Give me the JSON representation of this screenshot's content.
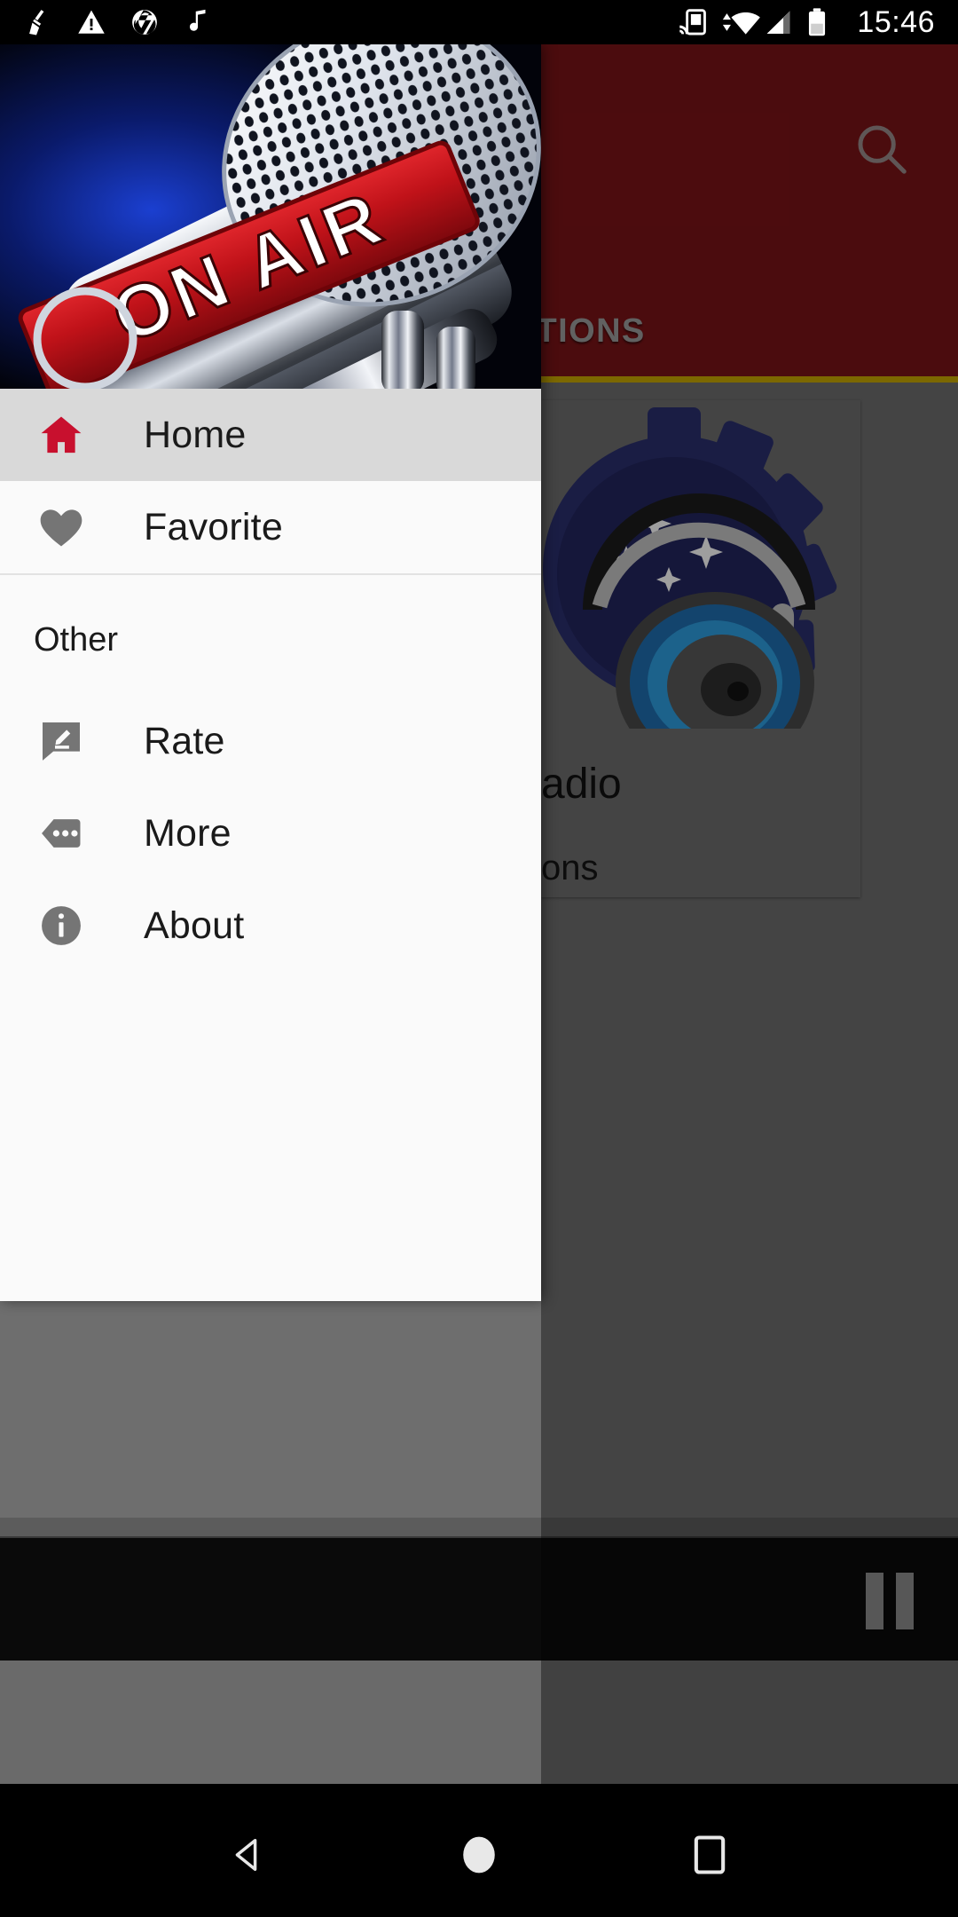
{
  "status_bar": {
    "time": "15:46",
    "left_icons": [
      "broom-icon",
      "warning-triangle-icon",
      "camera-aperture-icon",
      "music-note-icon"
    ],
    "right_icons": [
      "cast-icon",
      "wifi-icon",
      "signal-icon",
      "battery-icon"
    ]
  },
  "app": {
    "app_bar": {
      "search_icon": "search-icon",
      "background_color": "#7a1417"
    },
    "tabs": [
      {
        "label": "STATIONS",
        "selected": false
      }
    ],
    "tab_indicator_color": "#c8a800",
    "station_card": {
      "title": "adio",
      "subtitle": "ons",
      "logo_icon": "headphones-logo"
    },
    "player": {
      "button_label": "",
      "button_icon": "pause-icon"
    }
  },
  "drawer": {
    "header_image": "on-air-microphone-banner",
    "items": [
      {
        "label": "Home",
        "icon": "home-icon",
        "selected": true
      },
      {
        "label": "Favorite",
        "icon": "heart-icon",
        "selected": false
      }
    ],
    "section_title": "Other",
    "other_items": [
      {
        "label": "Rate",
        "icon": "rate-review-icon",
        "selected": false
      },
      {
        "label": "More",
        "icon": "more-tag-icon",
        "selected": false
      },
      {
        "label": "About",
        "icon": "info-circle-icon",
        "selected": false
      }
    ],
    "colors": {
      "background": "#fafafa",
      "selected_row": "#d9d9d9",
      "accent": "#c8102e",
      "icon_gray": "#757575"
    }
  },
  "navbar": {
    "buttons": [
      {
        "label": "Back",
        "icon": "back-triangle-icon"
      },
      {
        "label": "Home",
        "icon": "home-circle-icon"
      },
      {
        "label": "Recents",
        "icon": "recents-square-icon"
      }
    ]
  }
}
